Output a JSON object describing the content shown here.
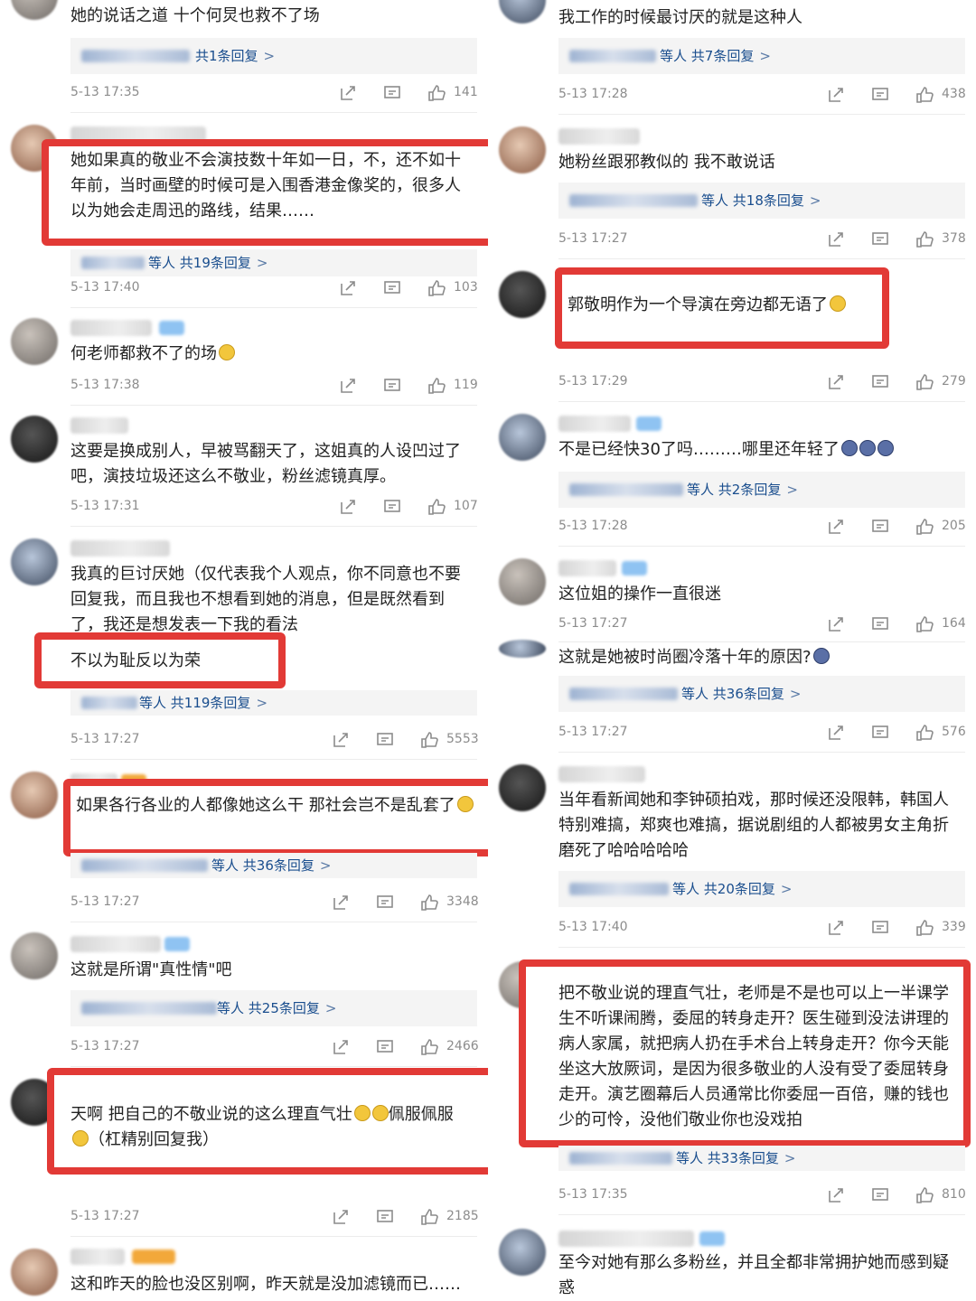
{
  "left": [
    {
      "text": "她的说话之道 十个何炅也救不了场",
      "reply": "共1条回复",
      "reply_prefix": "",
      "time": "5-13 17:35",
      "likes": "141"
    },
    {
      "text": "她如果真的敬业不会演技数十年如一日，不，还不如十年前，当时画壁的时候可是入围香港金像奖的，很多人以为她会走周迅的路线，结果……",
      "reply": "共19条回复",
      "reply_prefix": "等人",
      "time": "5-13 17:40",
      "likes": "103"
    },
    {
      "text": "何老师都救不了的场",
      "reply": "",
      "reply_prefix": "",
      "time": "5-13 17:38",
      "likes": "119"
    },
    {
      "text": "这要是换成别人，早被骂翻天了，这姐真的人设凹过了吧，演技垃圾还这么不敬业，粉丝滤镜真厚。",
      "reply": "",
      "reply_prefix": "",
      "time": "5-13 17:31",
      "likes": "107"
    },
    {
      "text": "我真的巨讨厌她（仅代表我个人观点，你不同意也不要回复我，而且我也不想看到她的消息，但是既然看到了，我还是想发表一下我的看法",
      "highlight": "不以为耻反以为荣",
      "reply": "共119条回复",
      "reply_prefix": "等人",
      "time": "5-13 17:27",
      "likes": "5553"
    },
    {
      "text": "如果各行各业的人都像她这么干 那社会岂不是乱套了",
      "reply": "共36条回复",
      "reply_prefix": "等人",
      "time": "5-13 17:27",
      "likes": "3348"
    },
    {
      "text": "这就是所谓\"真性情\"吧",
      "reply": "共25条回复",
      "reply_prefix": "等人",
      "time": "5-13 17:27",
      "likes": "2466"
    },
    {
      "text": "天啊 把自己的不敬业说的这么理直气壮",
      "text2": "佩服佩服",
      "text3": "（杠精别回复我）",
      "reply": "",
      "reply_prefix": "",
      "time": "5-13 17:27",
      "likes": "2185"
    },
    {
      "text": "这和昨天的脸也没区别啊，昨天就是没加滤镜而已……",
      "reply": "",
      "reply_prefix": "",
      "time": "",
      "likes": ""
    }
  ],
  "right": [
    {
      "text": "我工作的时候最讨厌的就是这种人",
      "reply": "共7条回复",
      "reply_prefix": "等人",
      "time": "5-13 17:28",
      "likes": "438"
    },
    {
      "text": "她粉丝跟邪教似的 我不敢说话",
      "reply": "共18条回复",
      "reply_prefix": "等人",
      "time": "5-13 17:27",
      "likes": "378"
    },
    {
      "text": "郭敬明作为一个导演在旁边都无语了",
      "reply": "",
      "reply_prefix": "",
      "time": "5-13 17:29",
      "likes": "279"
    },
    {
      "text": "不是已经快30了吗………哪里还年轻了",
      "reply": "共2条回复",
      "reply_prefix": "等人",
      "time": "5-13 17:28",
      "likes": "205"
    },
    {
      "text": "这位姐的操作一直很迷",
      "reply": "",
      "reply_prefix": "",
      "time": "5-13 17:27",
      "likes": "164"
    },
    {
      "text": "这就是她被时尚圈冷落十年的原因?",
      "reply": "共36条回复",
      "reply_prefix": "等人",
      "time": "5-13 17:27",
      "likes": "576"
    },
    {
      "text": "当年看新闻她和李钟硕拍戏，那时候还没限韩，韩国人特别难搞，郑爽也难搞，据说剧组的人都被男女主角折磨死了哈哈哈哈哈",
      "reply": "共20条回复",
      "reply_prefix": "等人",
      "time": "5-13 17:40",
      "likes": "339"
    },
    {
      "text": "把不敬业说的理直气壮，老师是不是也可以上一半课学生不听课闹腾，委屈的转身走开？医生碰到没法讲理的病人家属，就把病人扔在手术台上转身走开？你今天能坐这大放厥词，是因为很多敬业的人没有受了委屈转身走开。演艺圈幕后人员通常比你委屈一百倍，赚的钱也少的可怜，没他们敬业你也没戏拍",
      "reply": "共33条回复",
      "reply_prefix": "等人",
      "time": "5-13 17:35",
      "likes": "810"
    },
    {
      "text": "至今对她有那么多粉丝，并且全都非常拥护她而感到疑惑",
      "reply": "",
      "reply_prefix": "",
      "time": "",
      "likes": ""
    }
  ],
  "icons": {
    "share": "share-icon",
    "comment": "comment-icon",
    "like": "thumbs-up-icon",
    "emoji": "emoji-icon"
  },
  "colors": {
    "highlight": "#e23a36",
    "reply_link": "#1a4e8e",
    "meta": "#8c8c8c",
    "reply_bg": "#f4f4f4"
  }
}
